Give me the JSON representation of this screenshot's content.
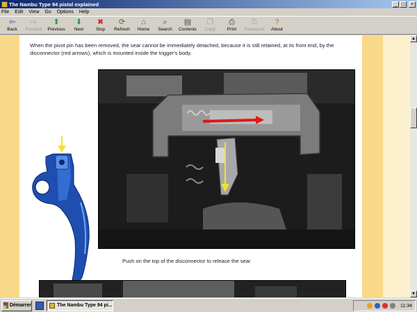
{
  "window": {
    "title": "The Nambu Type 94 pistol explained",
    "min_glyph": "_",
    "max_glyph": "□",
    "close_glyph": "×"
  },
  "menu": [
    "File",
    "Edit",
    "View",
    "Go",
    "Options",
    "Help"
  ],
  "toolbar": [
    {
      "label": "Back",
      "icon": "back-arrow-icon",
      "glyph": "⇦",
      "color": "#2a4ea8",
      "enabled": true
    },
    {
      "label": "Forward",
      "icon": "forward-arrow-icon",
      "glyph": "⇨",
      "color": "#a8a49c",
      "enabled": false
    },
    {
      "label": "Previous",
      "icon": "up-arrow-icon",
      "glyph": "⬆",
      "color": "#1aa03a",
      "enabled": true
    },
    {
      "label": "Next",
      "icon": "down-arrow-icon",
      "glyph": "⬇",
      "color": "#1aa03a",
      "enabled": true
    },
    {
      "label": "Stop",
      "icon": "stop-icon",
      "glyph": "✖",
      "color": "#d82020",
      "enabled": true
    },
    {
      "label": "Refresh",
      "icon": "refresh-icon",
      "glyph": "⟳",
      "color": "#2a7a2a",
      "enabled": true
    },
    {
      "label": "Home",
      "icon": "home-icon",
      "glyph": "⌂",
      "color": "#7a5a30",
      "enabled": true
    },
    {
      "label": "Search",
      "icon": "search-icon",
      "glyph": "⌕",
      "color": "#205090",
      "enabled": true
    },
    {
      "label": "Contents",
      "icon": "contents-icon",
      "glyph": "▤",
      "color": "#505050",
      "enabled": true
    },
    {
      "label": "Copy",
      "icon": "copy-icon",
      "glyph": "❐",
      "color": "#a8a49c",
      "enabled": false
    },
    {
      "label": "Print",
      "icon": "print-icon",
      "glyph": "⎙",
      "color": "#404040",
      "enabled": true
    },
    {
      "label": "Password",
      "icon": "key-icon",
      "glyph": "⚿",
      "color": "#a8a49c",
      "enabled": false
    },
    {
      "label": "About",
      "icon": "about-icon",
      "glyph": "?",
      "color": "#a08010",
      "enabled": true
    }
  ],
  "content": {
    "paragraph": "When the pivot pin has been removed, the sear cannot be immediately detached, because it is still retained, at its front end, by the disconnector (red arrows), which is mounted inside the trigger's body.",
    "caption": "Push on the top of the disconnector to release the sear",
    "colors": {
      "strip": "#fad88a",
      "strip_pale": "#fdf0cc",
      "trigger_blue": "#1e4fb0",
      "arrow_yellow": "#f4e030",
      "arrow_red": "#e01818"
    }
  },
  "taskbar": {
    "start_label": "Démarrer",
    "task_label": "The Nambu Type 94 pi...",
    "clock": "11:34"
  }
}
